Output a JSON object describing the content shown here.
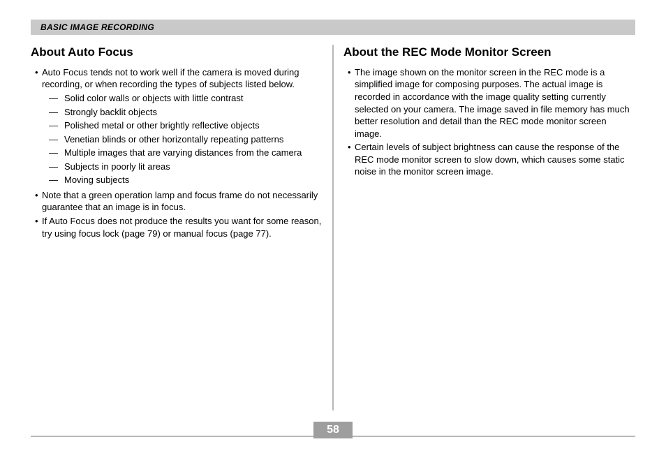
{
  "section_header": "BASIC IMAGE RECORDING",
  "page_number": "58",
  "left": {
    "heading": "About Auto Focus",
    "b1": "Auto Focus tends not to work well if the camera is moved during recording, or when recording the types of subjects listed below.",
    "d1": "Solid color walls or objects with little contrast",
    "d2": "Strongly backlit objects",
    "d3": "Polished metal or other brightly reflective objects",
    "d4": "Venetian blinds or other horizontally repeating patterns",
    "d5": "Multiple images that are varying distances from the camera",
    "d6": "Subjects in poorly lit areas",
    "d7": "Moving subjects",
    "b2": "Note that a green operation lamp and focus frame do not necessarily guarantee that an image is in focus.",
    "b3": "If Auto Focus does not produce the results you want for some reason, try using focus lock (page 79) or manual focus (page 77)."
  },
  "right": {
    "heading": "About the REC Mode Monitor Screen",
    "b1": "The image shown on the monitor screen in the REC mode is a simplified image for composing purposes. The actual image is recorded in accordance with the image quality setting currently selected on your camera. The image saved in file memory has much better resolution and detail than the REC mode monitor screen image.",
    "b2": "Certain levels of subject brightness can cause the response of the REC mode monitor screen to slow down, which causes some static noise in the monitor screen image."
  }
}
